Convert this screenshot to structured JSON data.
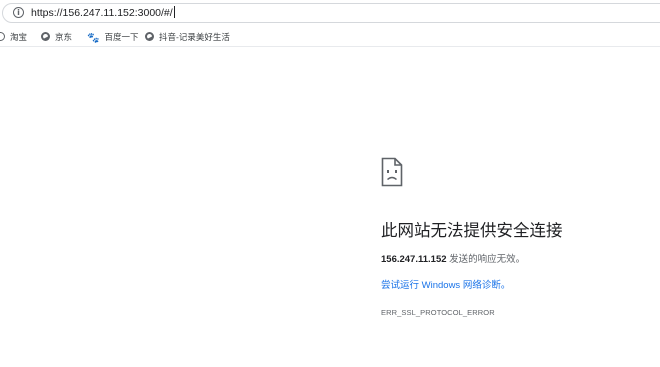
{
  "browser": {
    "address_bar": {
      "icon": "info-icon",
      "url": "https://156.247.11.152:3000/#/"
    },
    "bookmarks": [
      {
        "label": "淘宝",
        "icon": "taobao-icon"
      },
      {
        "label": "京东",
        "icon": "globe-icon"
      },
      {
        "label": "百度一下",
        "icon": "baidu-paw-icon"
      },
      {
        "label": "抖音-记录美好生活",
        "icon": "globe-icon"
      }
    ]
  },
  "error_page": {
    "icon": "sad-document-icon",
    "title": "此网站无法提供安全连接",
    "host": "156.247.11.152",
    "description_suffix": " 发送的响应无效。",
    "link_label": "尝试运行 Windows 网络诊断。",
    "error_code": "ERR_SSL_PROTOCOL_ERROR"
  }
}
